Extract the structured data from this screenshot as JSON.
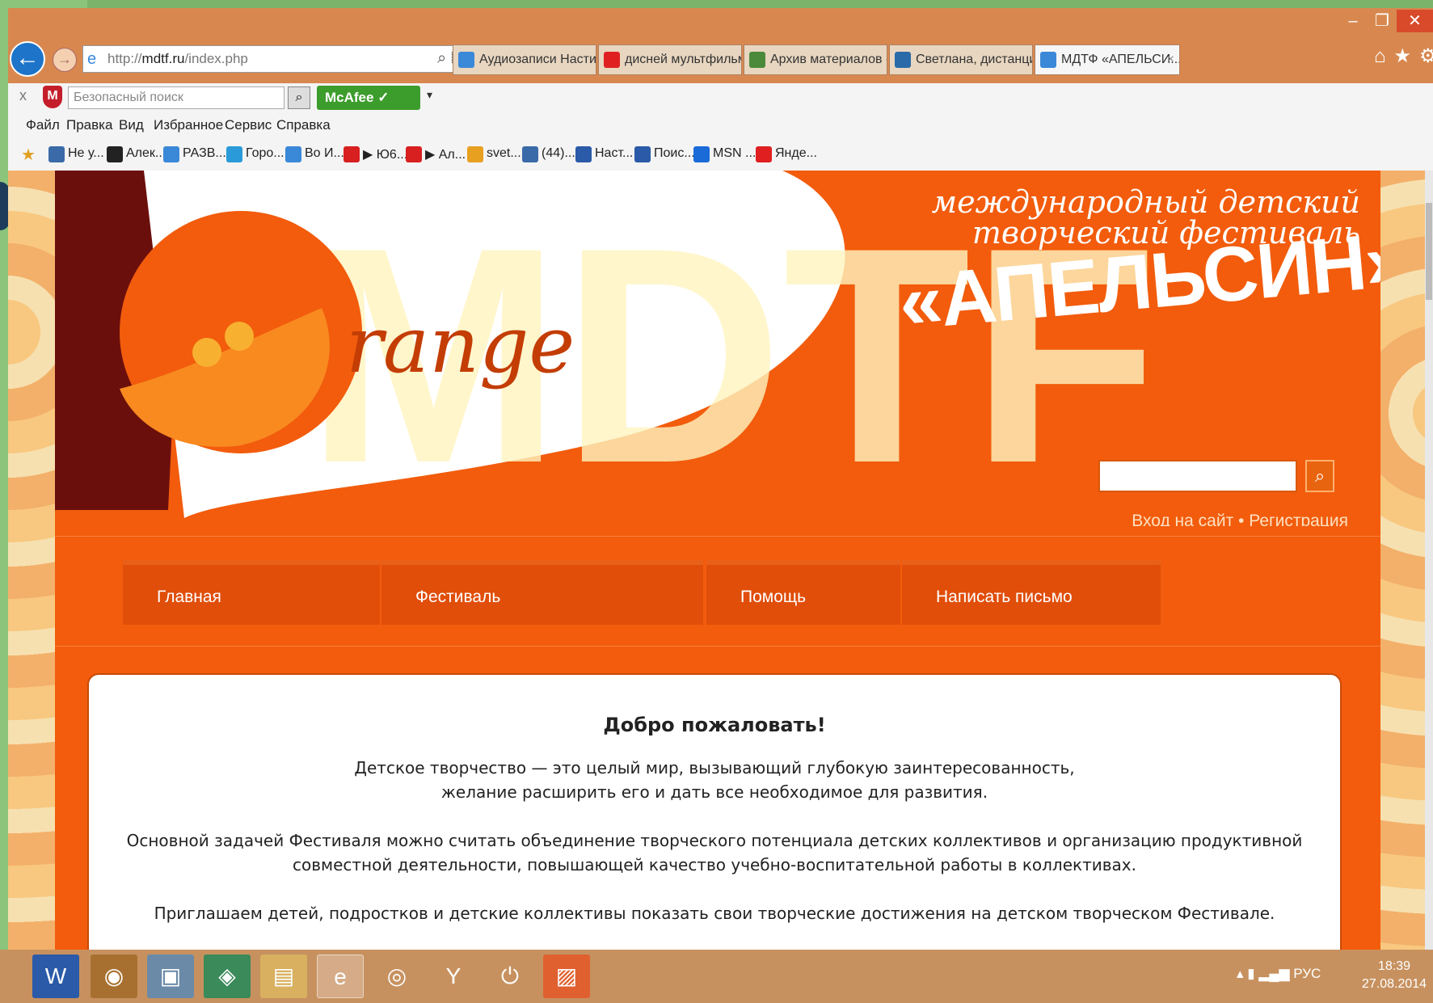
{
  "browser": {
    "address": {
      "prefix": "http://",
      "domain": "mdtf.ru",
      "path": "/index.php"
    },
    "tabs": [
      {
        "label": "Аудиозаписи Насти ...",
        "icon_color": "#3a88d8"
      },
      {
        "label": "дисней мультфильм...",
        "icon_color": "#e02020"
      },
      {
        "label": "Архив материалов - ...",
        "icon_color": "#4a8a3a"
      },
      {
        "label": "Светлана, дистанцио...",
        "icon_color": "#2a6aa8"
      },
      {
        "label": "МДТФ «АПЕЛЬСИ...",
        "icon_color": "#3a88d8",
        "active": true
      }
    ],
    "tab_close": "×",
    "window_controls": {
      "minimize": "–",
      "restore": "❐",
      "close": "✕"
    },
    "nav_icons": "⌂★⚙",
    "toolbar": {
      "close": "x",
      "safe_search_placeholder": "Безопасный поиск",
      "mcafee_label": "McAfee",
      "mcafee_dropdown": "▾"
    },
    "menu": [
      "Файл",
      "Правка",
      "Вид",
      "Избранное",
      "Сервис",
      "Справка"
    ],
    "favorites": [
      {
        "label": "Не у...",
        "icon_color": "#3a6aa8"
      },
      {
        "label": "Алек...",
        "icon_color": "#222"
      },
      {
        "label": "РАЗВ...",
        "icon_color": "#3a88d8"
      },
      {
        "label": "Горо...",
        "icon_color": "#2a9ad8"
      },
      {
        "label": "Во И...",
        "icon_color": "#3a88d8"
      },
      {
        "label": "▶ Ю6...",
        "icon_color": "#d82020"
      },
      {
        "label": "▶ Ал...",
        "icon_color": "#d82020"
      },
      {
        "label": "svet...",
        "icon_color": "#e8a020"
      },
      {
        "label": "(44)...",
        "icon_color": "#3a6aa8"
      },
      {
        "label": "Наст...",
        "icon_color": "#2a5aa8"
      },
      {
        "label": "Поис...",
        "icon_color": "#2a5aa8"
      },
      {
        "label": "MSN ...",
        "icon_color": "#1a6ad8"
      },
      {
        "label": "Янде...",
        "icon_color": "#e02020"
      }
    ]
  },
  "site": {
    "tagline_line1": "международный детский",
    "tagline_line2": "творческий фестиваль",
    "title": "«АПЕЛЬСИН»",
    "logo_word": "range",
    "logo_letters": "MDTF",
    "login": "Вход на сайт",
    "separator": "•",
    "register": "Регистрация",
    "nav": [
      "Главная",
      "Фестиваль",
      "Помощь",
      "Написать письмо"
    ],
    "welcome": "Добро пожаловать!",
    "paragraphs": [
      [
        "Детское творчество — это целый мир, вызывающий глубокую заинтересованность,",
        "желание расширить его и дать все необходимое для развития."
      ],
      [
        "Основной задачей Фестиваля можно считать объединение творческого потенциала детских коллективов и организацию продуктивной",
        "совместной деятельности, повышающей качество учебно-воспитательной работы в коллективах."
      ],
      [
        "Приглашаем детей, подростков и детские коллективы показать свои творческие достижения на детском творческом Фестивале."
      ]
    ]
  },
  "taskbar": {
    "tray_lang": "РУС",
    "tray_arrow": "▴",
    "time": "18:39",
    "date": "27.08.2014"
  },
  "colors": {
    "site_orange": "#f25c0c",
    "dark_red": "#6b0f0c",
    "nav_bg": "#e04e0a"
  }
}
